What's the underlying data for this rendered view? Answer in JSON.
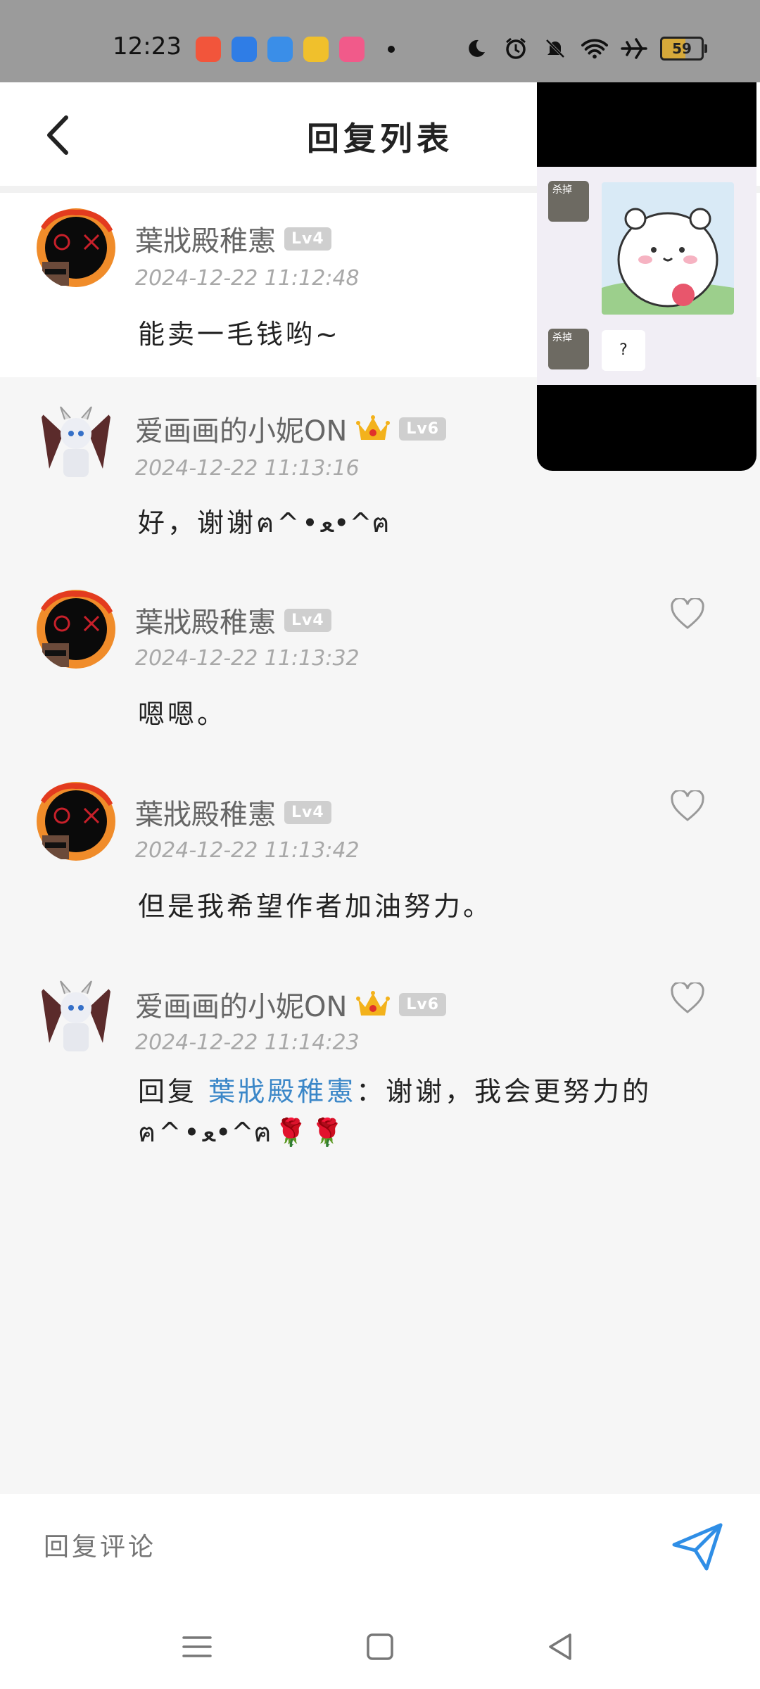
{
  "status_bar": {
    "time": "12:23",
    "battery": "59",
    "app_icon_colors": [
      "#f2553b",
      "#2f7de6",
      "#3a8ee8",
      "#f0c02c",
      "#f15a8a"
    ]
  },
  "header": {
    "title": "回复列表"
  },
  "comments": [
    {
      "username": "葉戕殿稚憲",
      "level": "Lv4",
      "crown": false,
      "timestamp": "2024-12-22 11:12:48",
      "text": "能卖一毛钱哟~",
      "highlight": true
    },
    {
      "username": "爱画画的小妮ON",
      "level": "Lv6",
      "crown": true,
      "timestamp": "2024-12-22 11:13:16",
      "text": "好，谢谢ฅ^•ﻌ•^ฅ"
    },
    {
      "username": "葉戕殿稚憲",
      "level": "Lv4",
      "crown": false,
      "timestamp": "2024-12-22 11:13:32",
      "text": "嗯嗯。"
    },
    {
      "username": "葉戕殿稚憲",
      "level": "Lv4",
      "crown": false,
      "timestamp": "2024-12-22 11:13:42",
      "text": "但是我希望作者加油努力。"
    },
    {
      "username": "爱画画的小妮ON",
      "level": "Lv6",
      "crown": true,
      "timestamp": "2024-12-22 11:14:23",
      "reply_prefix": "回复 ",
      "reply_mention": "葉戕殿稚憲",
      "reply_text": "：谢谢，我会更努力的ฅ^•ﻌ•^ฅ🌹🌹"
    }
  ],
  "overlay": {
    "avatar_label_1": "杀掉",
    "avatar_label_2": "杀掉",
    "bubble_text": "?"
  },
  "input": {
    "placeholder": "回复评论"
  },
  "colors": {
    "accent": "#3b87c8",
    "status_bar_bg": "#9b9b9b"
  }
}
